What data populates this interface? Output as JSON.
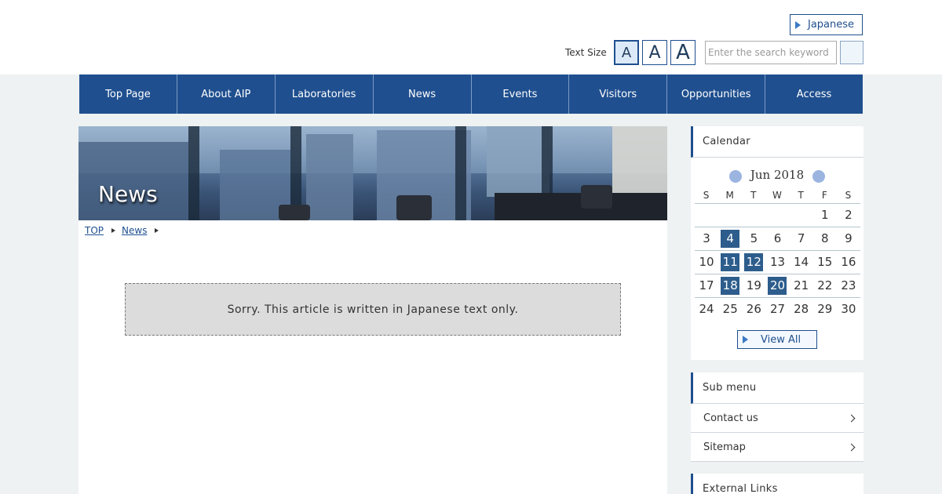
{
  "header": {
    "language_button": "Japanese",
    "text_size_label": "Text Size",
    "text_size_buttons": [
      "A",
      "A",
      "A"
    ],
    "search_placeholder": "Enter the search keyword"
  },
  "nav": {
    "items": [
      "Top Page",
      "About AIP",
      "Laboratories",
      "News",
      "Events",
      "Visitors",
      "Opportunities",
      "Access"
    ]
  },
  "main": {
    "banner_title": "News",
    "breadcrumb": [
      "TOP",
      "News"
    ],
    "notice": "Sorry. This article is written in Japanese text only."
  },
  "calendar": {
    "title": "Calendar",
    "month": "Jun 2018",
    "weekdays": [
      "S",
      "M",
      "T",
      "W",
      "T",
      "F",
      "S"
    ],
    "weeks": [
      [
        "",
        "",
        "",
        "",
        "",
        "1",
        "2"
      ],
      [
        "3",
        "4",
        "5",
        "6",
        "7",
        "8",
        "9"
      ],
      [
        "10",
        "11",
        "12",
        "13",
        "14",
        "15",
        "16"
      ],
      [
        "17",
        "18",
        "19",
        "20",
        "21",
        "22",
        "23"
      ],
      [
        "24",
        "25",
        "26",
        "27",
        "28",
        "29",
        "30"
      ]
    ],
    "event_days": [
      "4",
      "11",
      "12",
      "18",
      "20"
    ],
    "view_all": "View All"
  },
  "submenu": {
    "title": "Sub menu",
    "items": [
      "Contact us",
      "Sitemap"
    ]
  },
  "external_links": {
    "title": "External Links"
  },
  "colors": {
    "primary": "#1f4f8f",
    "event_day": "#2d5d8c",
    "background": "#eef2f2"
  }
}
